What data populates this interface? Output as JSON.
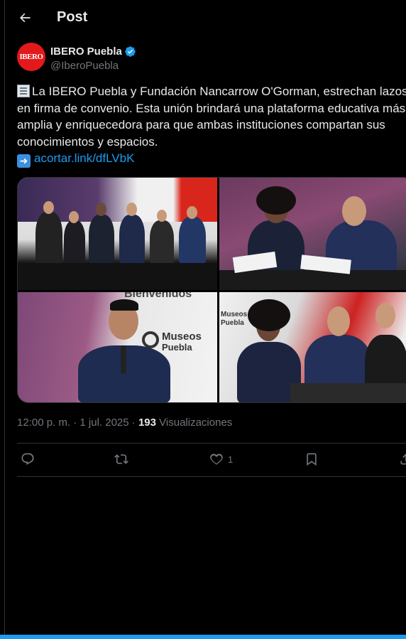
{
  "header": {
    "title": "Post"
  },
  "author": {
    "name": "IBERO Puebla",
    "handle": "@IberoPuebla",
    "avatar_text": "IBERO",
    "verified_color": "#1d9bf0"
  },
  "tweet": {
    "lines": [
      "La IBERO Puebla y Fundación Nancarrow O'Gorman, estrechan lazos",
      "en firma de convenio. Esta unión brindará una plataforma educativa más",
      "amplia y enriquecedora para que ambas instituciones compartan sus",
      "conocimientos y espacios."
    ],
    "link": "acortar.link/dfLVbK",
    "emoji_start": "newspaper-icon",
    "emoji_link": "right-arrow-icon"
  },
  "media": {
    "photo3_sign": "Museos",
    "photo3_sign2": "Puebla",
    "photo3_banner": "Bienvenidos",
    "photo4_sign": "Museos",
    "photo4_sign2": "Puebla"
  },
  "meta": {
    "time": "12:00 p. m.",
    "sep1": "·",
    "date": "1 jul. 2025",
    "sep2": "·",
    "views_count": "193",
    "views_label": "Visualizaciones"
  },
  "actions": {
    "reply_count": "",
    "repost_count": "",
    "like_count": "1"
  },
  "colors": {
    "accent": "#1d9bf0",
    "background": "#000000",
    "muted": "#71767b"
  }
}
